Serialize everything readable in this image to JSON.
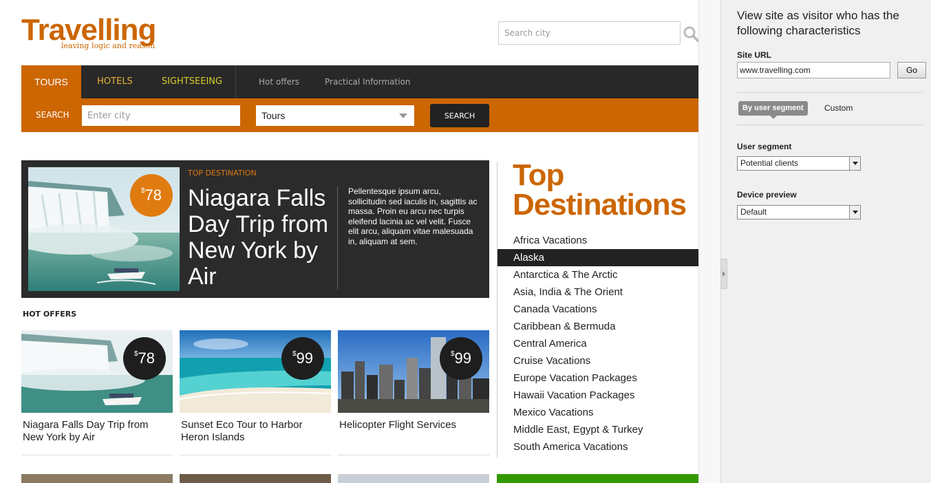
{
  "logo": {
    "name": "Travelling",
    "tagline": "leaving logic and reason"
  },
  "header": {
    "search_placeholder": "Search city"
  },
  "nav": {
    "tours": "TOURS",
    "hotels": "HOTELS",
    "sightseeing": "SIGHTSEEING",
    "hot_offers": "Hot offers",
    "practical": "Practical Information"
  },
  "searchbar": {
    "label": "SEARCH",
    "city_placeholder": "Enter city",
    "type_selected": "Tours",
    "button": "SEARCH"
  },
  "featured": {
    "kicker": "TOP DESTINATION",
    "currency": "$",
    "price": "78",
    "title": "Niagara Falls Day Trip from New York by Air",
    "description": "Pellentesque ipsum arcu, sollicitudin sed iaculis in, sagittis ac massa. Proin eu arcu nec turpis eleifend lacinia ac vel velit. Fusce elit arcu, aliquam vitae malesuada in, aliquam at sem."
  },
  "hot_offers": {
    "heading": "HOT OFFERS",
    "items": [
      {
        "currency": "$",
        "price": "78",
        "title": "Niagara Falls Day Trip from New York by Air"
      },
      {
        "currency": "$",
        "price": "99",
        "title": "Sunset Eco Tour to Harbor Heron Islands"
      },
      {
        "currency": "$",
        "price": "99",
        "title": "Helicopter Flight Services"
      }
    ]
  },
  "destinations": {
    "title": "Top Destinations",
    "items": [
      "Africa Vacations",
      "Alaska",
      "Antarctica & The Arctic",
      "Asia, India & The Orient",
      "Canada Vacations",
      "Caribbean & Bermuda",
      "Central America",
      "Cruise Vacations",
      "Europe Vacation Packages",
      "Hawaii Vacation Packages",
      "Mexico Vacations",
      "Middle East, Egypt & Turkey",
      "South America Vacations"
    ],
    "active_index": 1
  },
  "panel": {
    "heading": "View site as visitor who has the following characteristics",
    "site_url_label": "Site URL",
    "site_url_value": "www.travelling.com",
    "go_label": "Go",
    "tab_segment": "By user segment",
    "tab_custom": "Custom",
    "segment_label": "User segment",
    "segment_value": "Potential clients",
    "device_label": "Device preview",
    "device_value": "Default"
  },
  "colors": {
    "brand_orange": "#cc6600",
    "nav_dark": "#282828",
    "active_item": "#222222",
    "green_accent": "#339900"
  }
}
